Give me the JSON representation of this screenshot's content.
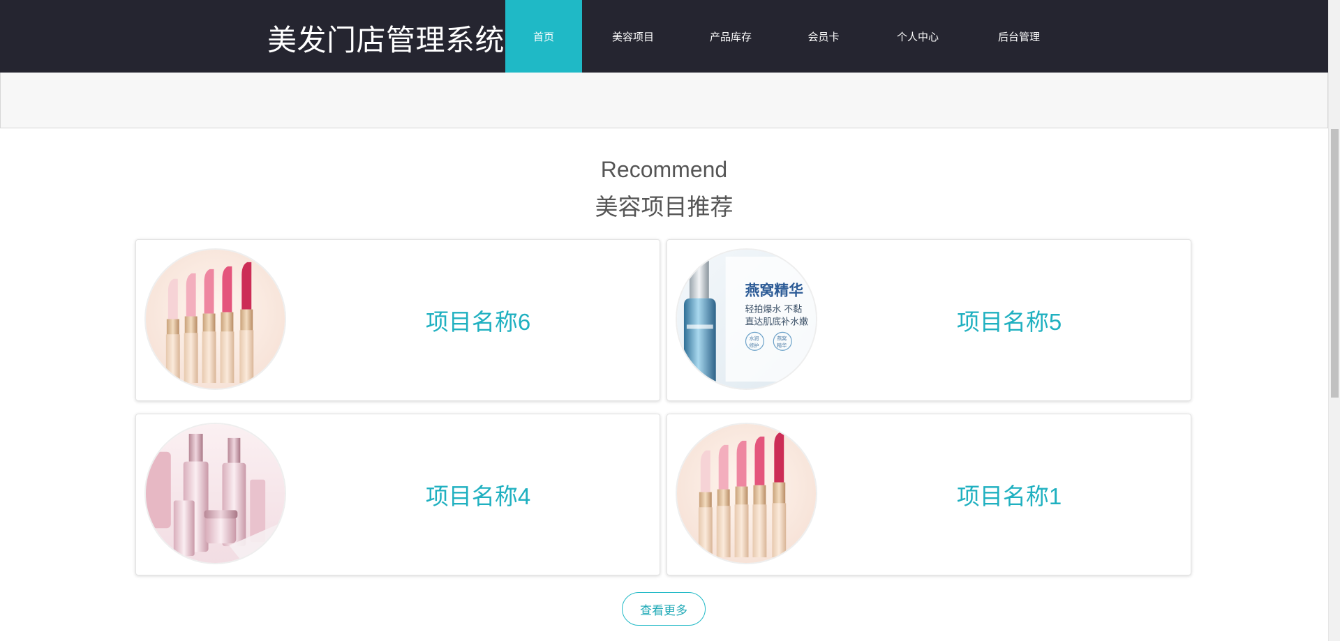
{
  "header": {
    "brand": "美发门店管理系统",
    "nav": [
      {
        "label": "首页",
        "active": true
      },
      {
        "label": "美容项目",
        "active": false
      },
      {
        "label": "产品库存",
        "active": false
      },
      {
        "label": "会员卡",
        "active": false
      },
      {
        "label": "个人中心",
        "active": false
      },
      {
        "label": "后台管理",
        "active": false
      }
    ]
  },
  "section": {
    "title_en": "Recommend",
    "title_cn": "美容项目推荐"
  },
  "cards": [
    {
      "title": "项目名称6",
      "image": "lipstick-row"
    },
    {
      "title": "项目名称5",
      "image": "serum-bottle",
      "image_text": [
        "燕窝精华",
        "轻拍爆水 不黏",
        "直达肌底补水嫩",
        "水润",
        "修护",
        "燕窝",
        "精华"
      ]
    },
    {
      "title": "项目名称4",
      "image": "cosmetic-bottles"
    },
    {
      "title": "项目名称1",
      "image": "lipstick-row"
    }
  ],
  "more_button": "查看更多",
  "colors": {
    "header_bg": "#252530",
    "accent": "#1fb9c6",
    "card_title": "#1fb0c0",
    "heading_text": "#555555"
  }
}
